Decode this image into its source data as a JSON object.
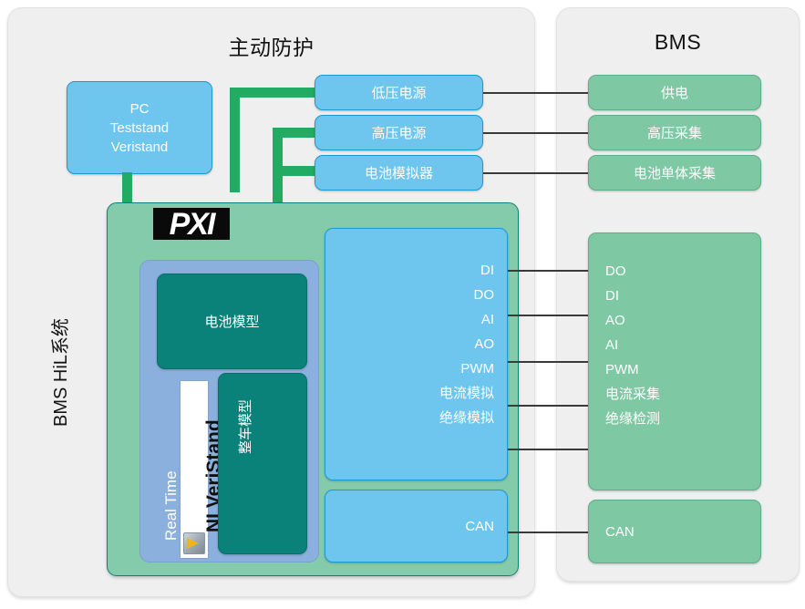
{
  "panels": {
    "left": {
      "title": "主动防护"
    },
    "right": {
      "title": "BMS"
    }
  },
  "system_label": "BMS HiL系统",
  "pxi": {
    "logo": "PXI"
  },
  "realtime": {
    "os_label": "Real Time",
    "software_label": "NI VeriStand"
  },
  "nodes": {
    "pc": {
      "line1": "PC",
      "line2": "Teststand",
      "line3": "Veristand"
    },
    "battery_model": "电池模型",
    "vehicle_model": "整车模型",
    "can_hil": "CAN",
    "can_bms": "CAN"
  },
  "power_chain": [
    {
      "hil": "低压电源",
      "bms": "供电"
    },
    {
      "hil": "高压电源",
      "bms": "高压采集"
    },
    {
      "hil": "电池模拟器",
      "bms": "电池单体采集"
    }
  ],
  "io_signals": {
    "hil": [
      "DI",
      "DO",
      "AI",
      "AO",
      "PWM",
      "电流模拟",
      "绝缘模拟"
    ],
    "bms": [
      "DO",
      "DI",
      "AO",
      "AI",
      "PWM",
      "电流采集",
      "绝缘检测"
    ]
  },
  "colors": {
    "panel_bg": "#efefef",
    "blue": "#6ec6ef",
    "blue_border": "#1b9ad6",
    "green": "#7ec8a4",
    "green_border": "#5fae8a",
    "teal": "#0b8279",
    "pxi_bg": "#84cbab",
    "realtime_bg": "#8bb0dd",
    "green_cable": "#22ab62",
    "wire": "#3a3a3a"
  }
}
